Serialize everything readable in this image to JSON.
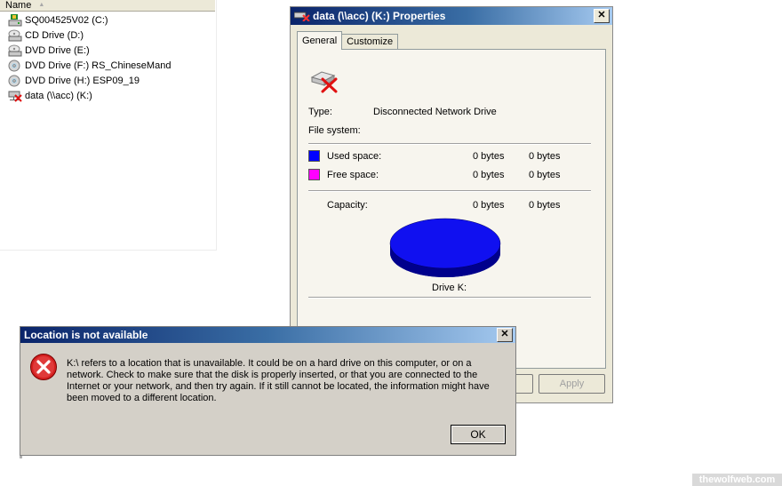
{
  "explorer": {
    "column_header": "Name",
    "drives": [
      {
        "label": "SQ004525V02 (C:)",
        "icon": "local-disk-icon"
      },
      {
        "label": "CD Drive (D:)",
        "icon": "cd-drive-icon"
      },
      {
        "label": "DVD Drive (E:)",
        "icon": "dvd-drive-icon"
      },
      {
        "label": "DVD Drive (F:) RS_ChineseMand",
        "icon": "dvd-disc-icon"
      },
      {
        "label": "DVD Drive (H:) ESP09_19",
        "icon": "dvd-disc-icon"
      },
      {
        "label": "data (\\\\acc) (K:)",
        "icon": "disconnected-network-drive-icon"
      }
    ]
  },
  "properties": {
    "title": "data (\\\\acc) (K:) Properties",
    "close_glyph": "✕",
    "tabs": [
      {
        "label": "General",
        "active": true
      },
      {
        "label": "Customize",
        "active": false
      }
    ],
    "type_label": "Type:",
    "type_value": "Disconnected Network Drive",
    "fs_label": "File system:",
    "used_label": "Used space:",
    "used_bytes": "0 bytes",
    "used_size": "0 bytes",
    "free_label": "Free space:",
    "free_bytes": "0 bytes",
    "free_size": "0 bytes",
    "capacity_label": "Capacity:",
    "capacity_bytes": "0 bytes",
    "capacity_size": "0 bytes",
    "drive_label": "Drive K:",
    "apply_label": "Apply",
    "colors": {
      "used": "#0000ff",
      "free": "#ff00ff",
      "pie_top": "#1010f0",
      "pie_side": "#00008c"
    }
  },
  "dialog": {
    "title": "Location is not available",
    "close_glyph": "✕",
    "message": "K:\\ refers to a location that is unavailable. It could be on a hard drive on this computer, or on a network. Check to make sure that the disk is properly inserted, or that you are connected to the Internet or your network, and then try again. If it still cannot be located, the information might have been moved to a different location.",
    "ok_label": "OK"
  },
  "watermark": "thewolfweb.com"
}
